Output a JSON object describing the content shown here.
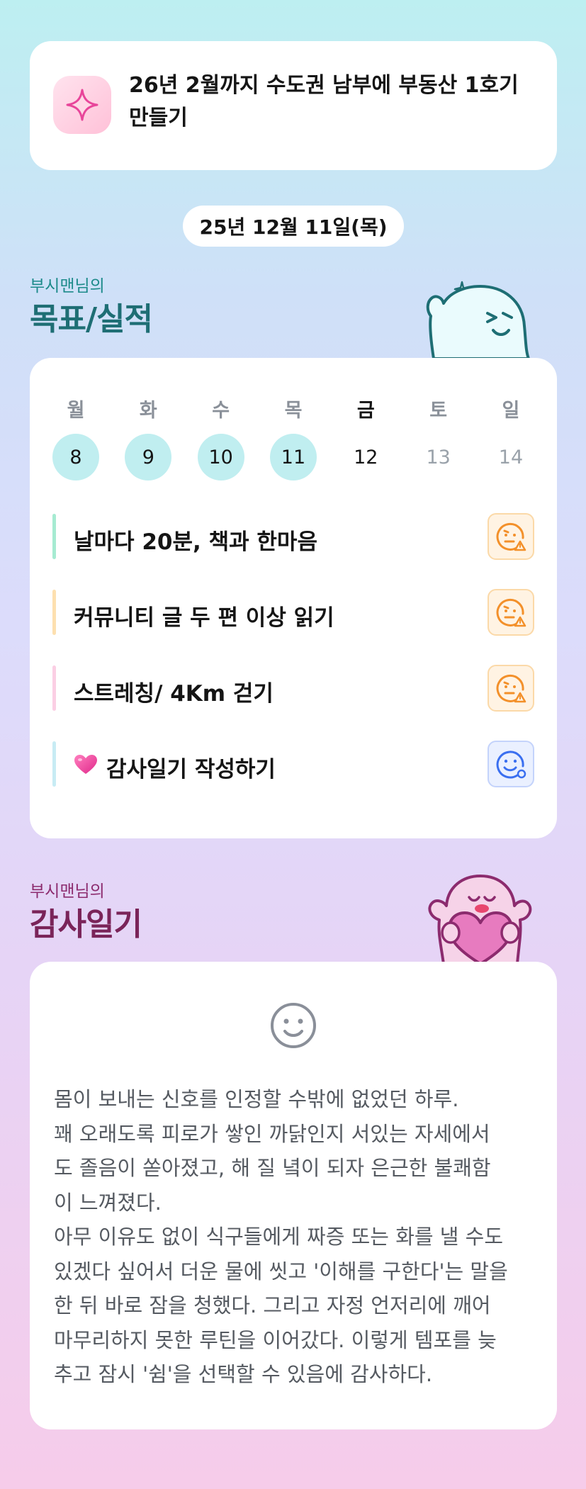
{
  "goal": {
    "icon": "sparkle-icon",
    "lines": [
      "26년 2월까지 수도권 남부에 부동산 1호기",
      "만들기"
    ]
  },
  "date_label": "25년 12월 11일(목)",
  "goals_section": {
    "subtitle": "부시맨님의",
    "title": "목표/실적"
  },
  "week": {
    "weekdays": [
      "월",
      "화",
      "수",
      "목",
      "금",
      "토",
      "일"
    ],
    "days": [
      {
        "num": "8",
        "state": "done"
      },
      {
        "num": "9",
        "state": "done"
      },
      {
        "num": "10",
        "state": "done"
      },
      {
        "num": "11",
        "state": "done"
      },
      {
        "num": "12",
        "state": "today"
      },
      {
        "num": "13",
        "state": "future"
      },
      {
        "num": "14",
        "state": "future"
      }
    ]
  },
  "tasks": [
    {
      "label": "날마다 20분, 책과 한마음",
      "bar_color": "#a6ebd2",
      "status_icon": "worried-face-warning-icon"
    },
    {
      "label": "커뮤니티 글 두 편 이상 읽기",
      "bar_color": "#fde0b0",
      "status_icon": "worried-face-warning-icon"
    },
    {
      "label": "스트레칭/ 4Km 걷기",
      "bar_color": "#fbcfe4",
      "status_icon": "worried-face-warning-icon"
    },
    {
      "label": "감사일기 작성하기",
      "bar_color": "#c8ecf4",
      "status_icon": "smile-face-check-icon",
      "prefix_icon": "heart-icon"
    }
  ],
  "gratitude_section": {
    "subtitle": "부시맨님의",
    "title": "감사일기"
  },
  "gratitude": {
    "mood_icon": "smile-face-icon",
    "lines": [
      "몸이 보내는 신호를 인정할 수밖에 없었던 하루.",
      "꽤 오래도록 피로가 쌓인 까닭인지 서있는 자세에서",
      "도 졸음이 쏟아졌고, 해 질 녘이 되자 은근한 불쾌함",
      "이 느껴졌다.",
      "아무 이유도 없이 식구들에게 짜증 또는 화를 낼 수도",
      "있겠다 싶어서 더운 물에 씻고 '이해를 구한다'는 말을",
      "한 뒤 바로 잠을 청했다. 그리고 자정 언저리에 깨어",
      "마무리하지 못한 루틴을 이어갔다. 이렇게 템포를 늦",
      "추고 잠시 '쉼'을 선택할 수 있음에 감사하다."
    ]
  }
}
